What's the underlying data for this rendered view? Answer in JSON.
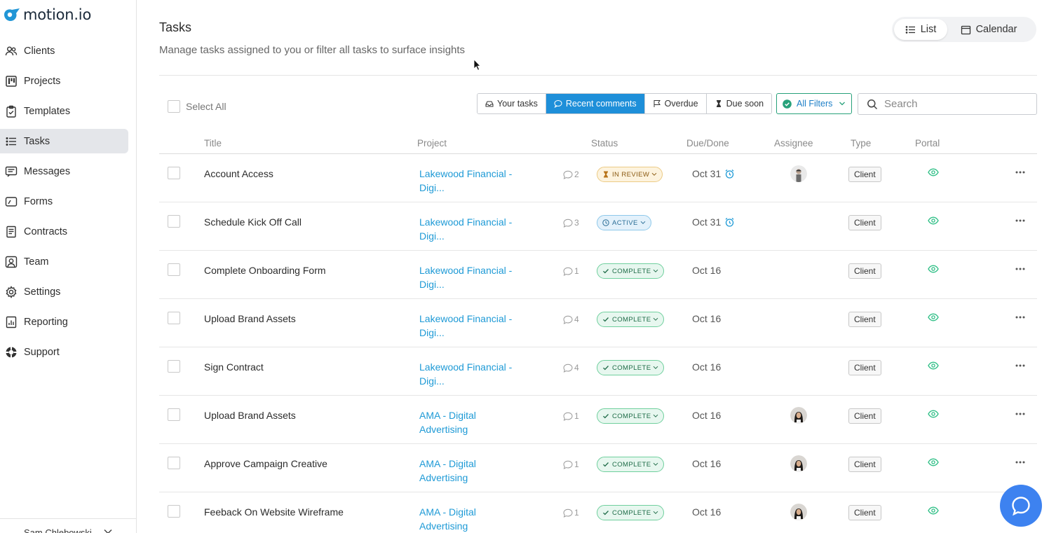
{
  "app": {
    "logo_text": "motion.io"
  },
  "sidebar": {
    "items": [
      {
        "label": "Clients",
        "icon": "users-icon",
        "active": false
      },
      {
        "label": "Projects",
        "icon": "kanban-icon",
        "active": false
      },
      {
        "label": "Templates",
        "icon": "clipboard-check-icon",
        "active": false
      },
      {
        "label": "Tasks",
        "icon": "list-icon",
        "active": true
      },
      {
        "label": "Messages",
        "icon": "message-icon",
        "active": false
      },
      {
        "label": "Forms",
        "icon": "form-icon",
        "active": false
      },
      {
        "label": "Contracts",
        "icon": "document-icon",
        "active": false
      },
      {
        "label": "Team",
        "icon": "team-icon",
        "active": false
      },
      {
        "label": "Settings",
        "icon": "gear-icon",
        "active": false
      },
      {
        "label": "Reporting",
        "icon": "chart-icon",
        "active": false
      },
      {
        "label": "Support",
        "icon": "lifebuoy-icon",
        "active": false
      }
    ],
    "user_name": "Sam Chlebowski"
  },
  "header": {
    "title": "Tasks",
    "subtitle": "Manage tasks assigned to you or filter all tasks to surface insights",
    "view_list": "List",
    "view_calendar": "Calendar"
  },
  "toolbar": {
    "select_all": "Select All",
    "filters": [
      "Your tasks",
      "Recent comments",
      "Overdue",
      "Due soon"
    ],
    "active_filter": "Recent comments",
    "all_filters": "All Filters",
    "search_placeholder": "Search"
  },
  "table": {
    "columns": [
      "Title",
      "Project",
      "Status",
      "Due/Done",
      "Assignee",
      "Type",
      "Portal"
    ],
    "rows": [
      {
        "title": "Account Access",
        "project_line1": "Lakewood Financial -",
        "project_line2": "Digi...",
        "comments": "2",
        "status": "IN REVIEW",
        "status_kind": "review",
        "due": "Oct 31",
        "alarm": true,
        "assignee": "man",
        "type": "Client"
      },
      {
        "title": "Schedule Kick Off Call",
        "project_line1": "Lakewood Financial -",
        "project_line2": "Digi...",
        "comments": "3",
        "status": "ACTIVE",
        "status_kind": "active",
        "due": "Oct 31",
        "alarm": true,
        "assignee": "",
        "type": "Client"
      },
      {
        "title": "Complete Onboarding Form",
        "project_line1": "Lakewood Financial -",
        "project_line2": "Digi...",
        "comments": "1",
        "status": "COMPLETE",
        "status_kind": "complete",
        "due": "Oct 16",
        "alarm": false,
        "assignee": "",
        "type": "Client"
      },
      {
        "title": "Upload Brand Assets",
        "project_line1": "Lakewood Financial -",
        "project_line2": "Digi...",
        "comments": "4",
        "status": "COMPLETE",
        "status_kind": "complete",
        "due": "Oct 16",
        "alarm": false,
        "assignee": "",
        "type": "Client"
      },
      {
        "title": "Sign Contract",
        "project_line1": "Lakewood Financial -",
        "project_line2": "Digi...",
        "comments": "4",
        "status": "COMPLETE",
        "status_kind": "complete",
        "due": "Oct 16",
        "alarm": false,
        "assignee": "",
        "type": "Client"
      },
      {
        "title": "Upload Brand Assets",
        "project_line1": "AMA - Digital",
        "project_line2": "Advertising",
        "comments": "1",
        "status": "COMPLETE",
        "status_kind": "complete",
        "due": "Oct 16",
        "alarm": false,
        "assignee": "woman",
        "type": "Client"
      },
      {
        "title": "Approve Campaign Creative",
        "project_line1": "AMA - Digital",
        "project_line2": "Advertising",
        "comments": "1",
        "status": "COMPLETE",
        "status_kind": "complete",
        "due": "Oct 16",
        "alarm": false,
        "assignee": "woman",
        "type": "Client"
      },
      {
        "title": "Feeback On Website Wireframe",
        "project_line1": "AMA - Digital",
        "project_line2": "Advertising",
        "comments": "1",
        "status": "COMPLETE",
        "status_kind": "complete",
        "due": "Oct 16",
        "alarm": false,
        "assignee": "woman",
        "type": "Client"
      }
    ]
  },
  "colors": {
    "accent": "#1e8fd9",
    "link": "#1e9ad6",
    "complete": "#6fcf9d",
    "help": "#3d82f0"
  }
}
